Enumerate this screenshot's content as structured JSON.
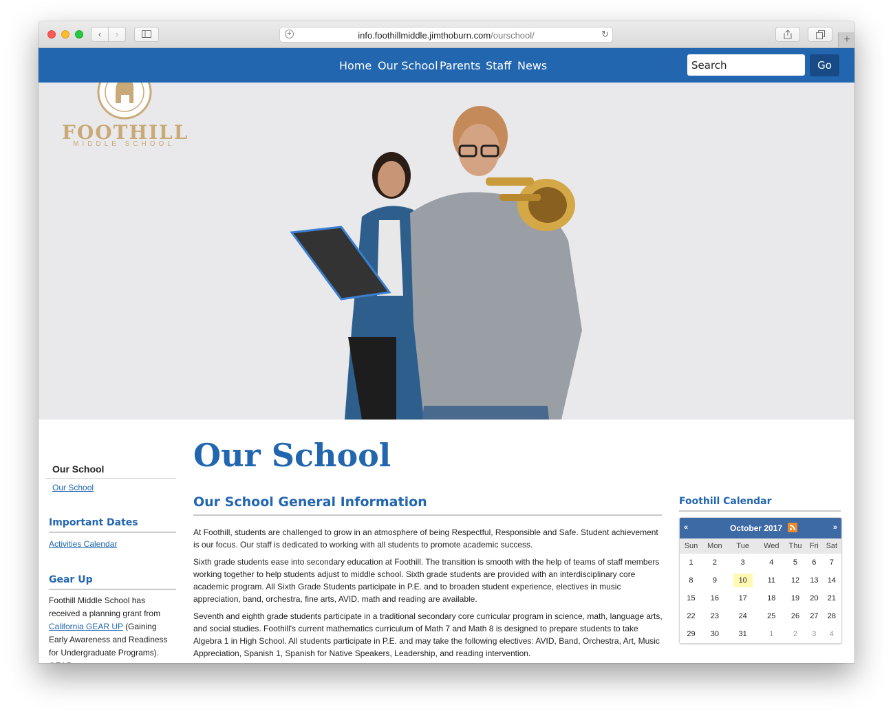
{
  "browser": {
    "url_host": "info.foothillmiddle.jimthoburn.com",
    "url_path": "/ourschool/"
  },
  "nav": {
    "items": [
      "Home",
      "Our School",
      "Parents",
      "Staff",
      "News"
    ],
    "search_placeholder": "Search",
    "go_label": "Go"
  },
  "logo": {
    "name": "FOOTHILL",
    "subtitle": "MIDDLE SCHOOL"
  },
  "page": {
    "title": "Our School",
    "section_heading": "Our School General Information",
    "paragraphs": [
      "At Foothill, students are challenged to grow in an atmosphere of being Respectful, Responsible and Safe.  Student achievement is our focus.  Our staff is dedicated to working with all students to promote academic success.",
      "Sixth grade students ease into secondary education at Foothill.  The transition is smooth with the help of teams of staff members working together to help students adjust to middle school.  Sixth grade students are provided with an interdisciplinary core academic program.  All Sixth Grade Students participate in P.E. and to broaden student experience, electives in music appreciation, band, orchestra, fine arts, AVID, math and reading are available.",
      "Seventh and eighth grade students participate in a traditional secondary core curricular program in science, math, language arts, and social studies.  Foothill's current mathematics curriculum of Math 7 and Math 8 is designed to prepare students to take Algebra 1 in High School.  All students participate in P.E. and may take the following electives:  AVID, Band, Orchestra, Art, Music Appreciation, Spanish 1, Spanish for Native Speakers, Leadership, and reading intervention."
    ]
  },
  "sidebar": {
    "nav_heading": "Our School",
    "nav_link": "Our School",
    "important_dates": {
      "heading": "Important Dates",
      "link": "Activities Calendar"
    },
    "gear_up": {
      "heading": "Gear Up",
      "text_before": "Foothill Middle School has received a planning grant from ",
      "link": "California GEAR UP",
      "text_after": " (Gaining Early Awareness and Readiness for Undergraduate Programs). GEAR"
    }
  },
  "calendar": {
    "heading": "Foothill Calendar",
    "prev": "«",
    "next": "»",
    "month": "October 2017",
    "weekdays": [
      "Sun",
      "Mon",
      "Tue",
      "Wed",
      "Thu",
      "Fri",
      "Sat"
    ],
    "weeks": [
      [
        "1",
        "2",
        "3",
        "4",
        "5",
        "6",
        "7"
      ],
      [
        "8",
        "9",
        "10",
        "11",
        "12",
        "13",
        "14"
      ],
      [
        "15",
        "16",
        "17",
        "18",
        "19",
        "20",
        "21"
      ],
      [
        "22",
        "23",
        "24",
        "25",
        "26",
        "27",
        "28"
      ],
      [
        "29",
        "30",
        "31",
        "1",
        "2",
        "3",
        "4"
      ]
    ],
    "today": "10"
  },
  "colors": {
    "brand_blue": "#2266b0",
    "logo_gold": "#c9a978",
    "calendar_header": "#3d6aa5",
    "today_highlight": "#fff9b3"
  }
}
